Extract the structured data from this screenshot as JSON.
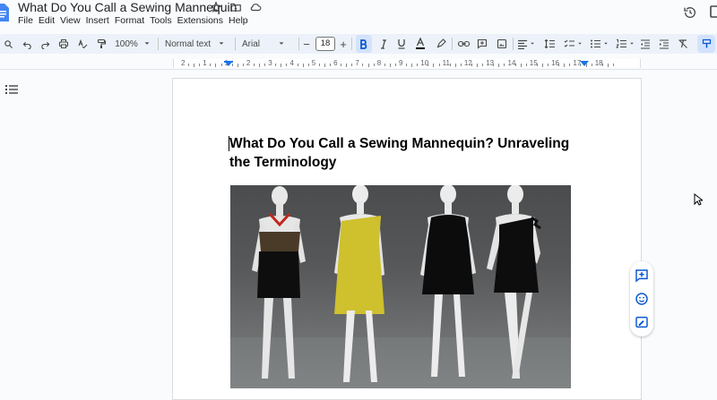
{
  "document": {
    "title": "What Do You Call a Sewing Mannequin",
    "heading": "What Do You Call a Sewing Mannequin? Unraveling the Terminology"
  },
  "menu": [
    "File",
    "Edit",
    "View",
    "Insert",
    "Format",
    "Tools",
    "Extensions",
    "Help"
  ],
  "toolbar": {
    "zoom": "100%",
    "style": "Normal text",
    "font": "Arial",
    "font_size": "18",
    "decrease_label": "−",
    "increase_label": "+"
  },
  "ruler": {
    "numbers": [
      "2",
      "1",
      "1",
      "2",
      "3",
      "4",
      "5",
      "6",
      "7",
      "8",
      "9",
      "10",
      "11",
      "12",
      "13",
      "14",
      "15",
      "16",
      "17",
      "18"
    ]
  },
  "icons": {
    "title_icons": [
      "star-icon",
      "move-to-folder-icon",
      "cloud-status-icon"
    ],
    "toolbar_icons": [
      "search-icon",
      "undo-icon",
      "redo-icon",
      "print-icon",
      "spellcheck-icon",
      "paint-format-icon",
      "bold-icon",
      "italic-icon",
      "underline-icon",
      "text-color-icon",
      "highlight-icon",
      "link-icon",
      "add-comment-icon",
      "insert-image-icon",
      "align-icon",
      "line-spacing-icon",
      "checklist-icon",
      "bulleted-list-icon",
      "numbered-list-icon",
      "decrease-indent-icon",
      "increase-indent-icon",
      "clear-formatting-icon",
      "editing-mode-icon"
    ],
    "side_icons": [
      "add-comment-icon",
      "add-emoji-icon",
      "suggest-edits-icon"
    ]
  },
  "colors": {
    "accent": "#0b57d0",
    "doc_blue": "#4285f4",
    "toolbar_bg": "#edf2fa",
    "bold_active": "#d3e3fd"
  }
}
